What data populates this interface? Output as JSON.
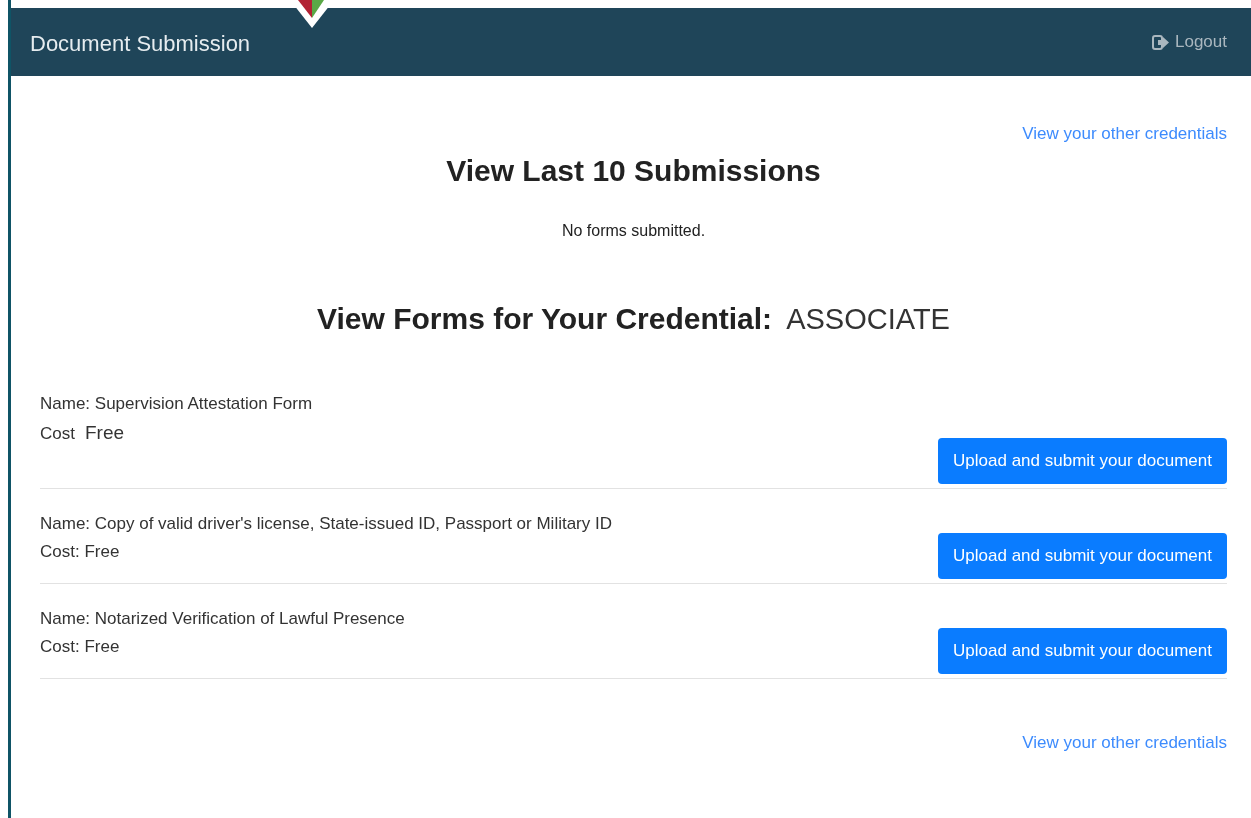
{
  "header": {
    "title": "Document Submission",
    "logout": "Logout"
  },
  "top_link": "View your other credentials",
  "submissions": {
    "title": "View Last 10 Submissions",
    "empty": "No forms submitted."
  },
  "credential": {
    "title": "View Forms for Your Credential:",
    "value": "ASSOCIATE"
  },
  "forms": [
    {
      "kind": "split",
      "name": "Name: Supervision Attestation Form",
      "cost_label": "Cost",
      "cost_value": "Free",
      "button": "Upload and submit your document"
    },
    {
      "kind": "plain",
      "name": "Name: Copy of valid driver's license, State-issued ID, Passport or Military ID",
      "cost": "Cost: Free",
      "button": "Upload and submit your document"
    },
    {
      "kind": "plain",
      "name": "Name: Notarized Verification of Lawful Presence",
      "cost": "Cost: Free",
      "button": "Upload and submit your document"
    }
  ],
  "bottom_link": "View your other credentials"
}
